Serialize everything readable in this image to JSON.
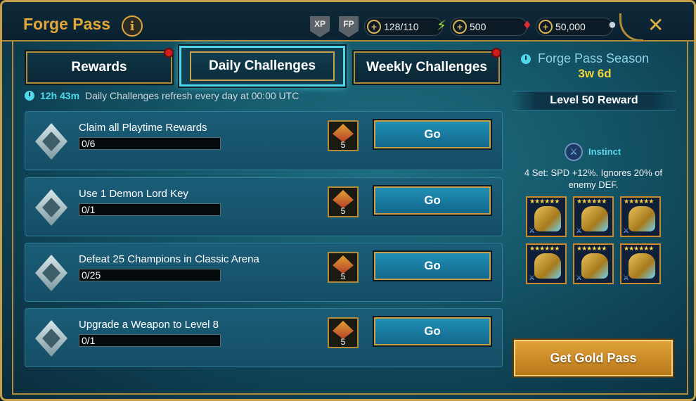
{
  "header": {
    "title": "Forge Pass",
    "info_symbol": "i",
    "xp_badge": "XP",
    "fp_badge": "FP",
    "resources": {
      "energy": "128/110",
      "gems": "500",
      "silver": "50,000"
    },
    "plus_symbol": "+",
    "close_symbol": "✕"
  },
  "tabs": [
    {
      "label": "Rewards",
      "notify": true,
      "active": false
    },
    {
      "label": "Daily Challenges",
      "notify": false,
      "active": true
    },
    {
      "label": "Weekly Challenges",
      "notify": true,
      "active": false
    }
  ],
  "refresh": {
    "timer": "12h 43m",
    "note": "Daily Challenges refresh every day at 00:00 UTC"
  },
  "challenges": [
    {
      "title": "Claim all Playtime Rewards",
      "progress": "0/6",
      "reward": "5",
      "button": "Go"
    },
    {
      "title": "Use 1 Demon Lord Key",
      "progress": "0/1",
      "reward": "5",
      "button": "Go"
    },
    {
      "title": "Defeat 25 Champions in Classic Arena",
      "progress": "0/25",
      "reward": "5",
      "button": "Go"
    },
    {
      "title": "Upgrade a Weapon to Level 8",
      "progress": "0/1",
      "reward": "5",
      "button": "Go"
    }
  ],
  "season": {
    "label": "Forge Pass Season",
    "time_left": "3w 6d",
    "level_reward": "Level 50 Reward",
    "set_name": "Instinct",
    "set_description": "4 Set: SPD +12%. Ignores 20% of enemy DEF.",
    "gear_stars": "★★★★★★",
    "gear_count": 6,
    "gold_pass_button": "Get Gold Pass"
  },
  "colors": {
    "accent_gold": "#c9a04a",
    "active_tab_glow": "#4fd7ea",
    "season_time": "#f0d43a"
  }
}
